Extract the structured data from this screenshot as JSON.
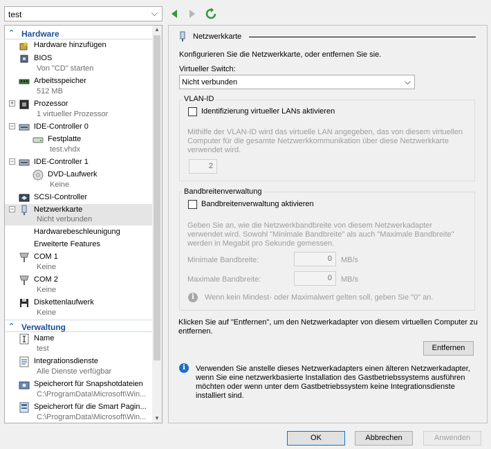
{
  "vm_selector": {
    "value": "test"
  },
  "navigation": {
    "back_icon": "green-left-arrow-icon",
    "forward_icon": "gray-right-arrow-icon",
    "refresh_icon": "green-refresh-icon"
  },
  "tree": {
    "hardware_section": "Hardware",
    "management_section": "Verwaltung",
    "items": {
      "add_hardware": {
        "label": "Hardware hinzufügen"
      },
      "bios": {
        "label": "BIOS",
        "detail": "Von \"CD\" starten"
      },
      "memory": {
        "label": "Arbeitsspeicher",
        "detail": "512 MB"
      },
      "processor": {
        "label": "Prozessor",
        "detail": "1 virtueller Prozessor"
      },
      "ide0": {
        "label": "IDE-Controller 0"
      },
      "hdd": {
        "label": "Festplatte",
        "detail": "test.vhdx"
      },
      "ide1": {
        "label": "IDE-Controller 1"
      },
      "dvd": {
        "label": "DVD-Laufwerk",
        "detail": "Keine"
      },
      "scsi": {
        "label": "SCSI-Controller"
      },
      "nic": {
        "label": "Netzwerkkarte",
        "detail": "Nicht verbunden"
      },
      "hw_accel": {
        "label": "Hardwarebeschleunigung"
      },
      "adv_features": {
        "label": "Erweiterte Features"
      },
      "com1": {
        "label": "COM 1",
        "detail": "Keine"
      },
      "com2": {
        "label": "COM 2",
        "detail": "Keine"
      },
      "floppy": {
        "label": "Diskettenlaufwerk",
        "detail": "Keine"
      },
      "name": {
        "label": "Name",
        "detail": "test"
      },
      "integration": {
        "label": "Integrationsdienste",
        "detail": "Alle Dienste verfügbar"
      },
      "snapshot": {
        "label": "Speicherort für Snapshotdateien",
        "detail": "C:\\ProgramData\\Microsoft\\Win..."
      },
      "smartpaging": {
        "label": "Speicherort für die Smart Pagin...",
        "detail": "C:\\ProgramData\\Microsoft\\Win..."
      }
    }
  },
  "panel": {
    "title": "Netzwerkkarte",
    "intro": "Konfigurieren Sie die Netzwerkkarte, oder entfernen Sie sie.",
    "switch_label": "Virtueller Switch:",
    "switch_value": "Nicht verbunden",
    "vlan": {
      "group_label": "VLAN-ID",
      "checkbox_label": "Identifizierung virtueller LANs aktivieren",
      "desc": [
        "Mithilfe der VLAN-ID wird das virtuelle LAN angegeben, das von diesem virtuellen",
        "Computer für die gesamte Netzwerkkommunikation über diese Netzwerkkarte",
        "verwendet wird."
      ],
      "value": "2"
    },
    "bandwidth": {
      "group_label": "Bandbreitenverwaltung",
      "checkbox_label": "Bandbreitenverwaltung aktivieren",
      "desc": [
        "Geben Sie an, wie die Netzwerkbandbreite von diesem Netzwerkadapter",
        "verwendet wird. Sowohl \"Minimale Bandbreite\" als auch \"Maximale Bandbreite\"",
        "werden in Megabit pro Sekunde gemessen."
      ],
      "min_label": "Minimale Bandbreite:",
      "min_value": "0",
      "max_label": "Maximale Bandbreite:",
      "max_value": "0",
      "unit": "MB/s",
      "hint": "Wenn kein Mindest- oder Maximalwert gelten soll, geben Sie \"0\" an."
    },
    "remove_text": [
      "Klicken Sie auf \"Entfernen\", um den Netzwerkadapter von diesem virtuellen Computer zu",
      "entfernen."
    ],
    "remove_button": "Entfernen",
    "legacy_info": [
      "Verwenden Sie anstelle dieses Netzwerkadapters einen älteren Netzwerkadapter,",
      "wenn Sie eine netzwerkbasierte Installation des Gastbetriebssystems ausführen",
      "möchten oder wenn unter dem Gastbetriebssystem keine Integrationsdienste",
      "installiert sind."
    ]
  },
  "footer": {
    "ok": "OK",
    "cancel": "Abbrechen",
    "apply": "Anwenden"
  },
  "colors": {
    "section_header": "#1f4d9a",
    "selection": "#e5e5e5",
    "info_blue": "#1e6ec8",
    "nav_green": "#2e9b3a"
  }
}
